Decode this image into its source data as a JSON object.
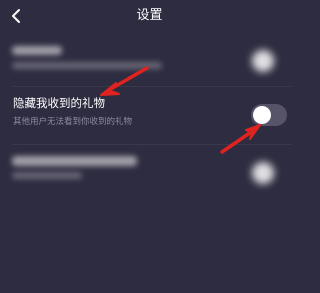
{
  "header": {
    "title": "设置",
    "back_icon": "chevron-left-icon"
  },
  "settings": {
    "hide_gifts": {
      "label": "隐藏我收到的礼物",
      "description": "其他用户无法看到你收到的礼物",
      "enabled": false
    }
  },
  "colors": {
    "background": "#2e2c40",
    "toggle_track": "#575469",
    "annotation_arrow": "#e0231f",
    "secondary_text": "#8d8aa3"
  }
}
